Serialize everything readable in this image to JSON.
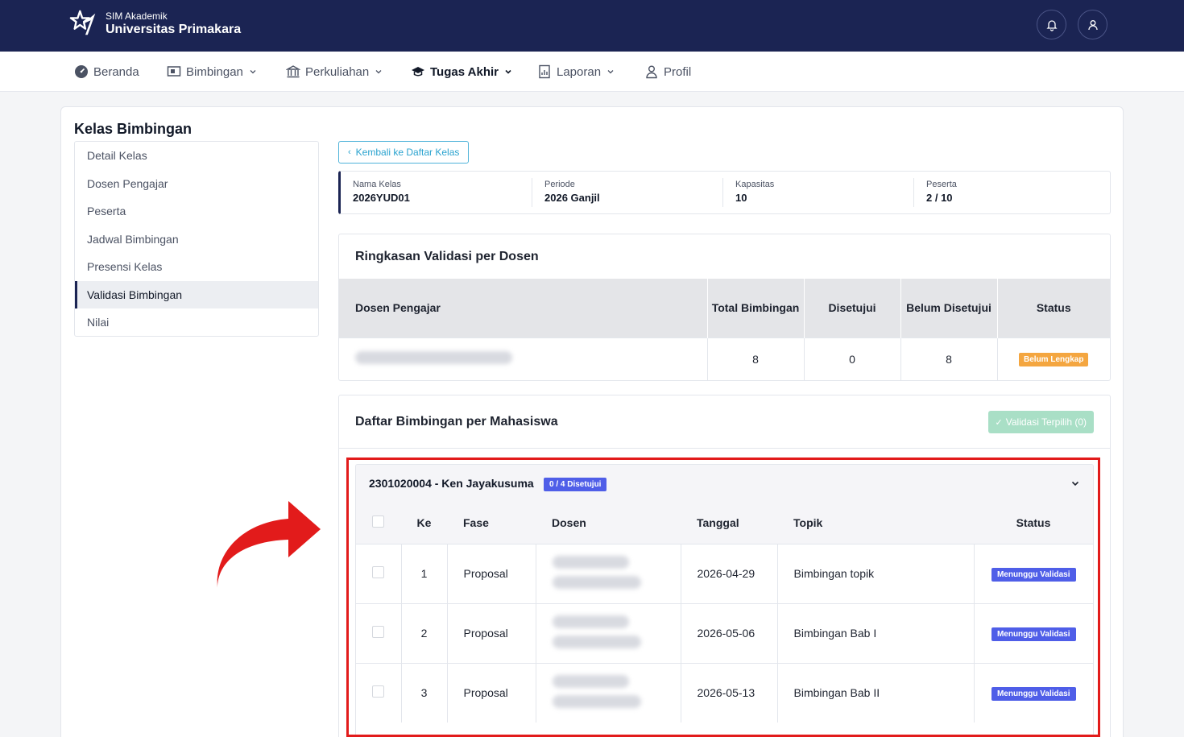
{
  "app": {
    "subtitle": "SIM Akademik",
    "title": "Universitas Primakara"
  },
  "header_icons": [
    "bell-icon",
    "user-icon"
  ],
  "nav": [
    {
      "label": "Beranda",
      "icon": "dashboard-icon",
      "dropdown": false,
      "active": false
    },
    {
      "label": "Bimbingan",
      "icon": "monitor-icon",
      "dropdown": true,
      "active": false
    },
    {
      "label": "Perkuliahan",
      "icon": "building-icon",
      "dropdown": true,
      "active": false
    },
    {
      "label": "Tugas Akhir",
      "icon": "graduation-cap-icon",
      "dropdown": true,
      "active": true
    },
    {
      "label": "Laporan",
      "icon": "report-icon",
      "dropdown": true,
      "active": false
    },
    {
      "label": "Profil",
      "icon": "person-icon",
      "dropdown": false,
      "active": false
    }
  ],
  "page_title": "Kelas Bimbingan",
  "sidebar": [
    {
      "label": "Detail Kelas",
      "active": false
    },
    {
      "label": "Dosen Pengajar",
      "active": false
    },
    {
      "label": "Peserta",
      "active": false
    },
    {
      "label": "Jadwal Bimbingan",
      "active": false
    },
    {
      "label": "Presensi Kelas",
      "active": false
    },
    {
      "label": "Validasi Bimbingan",
      "active": true
    },
    {
      "label": "Nilai",
      "active": false
    }
  ],
  "back_button": "Kembali ke Daftar Kelas",
  "info": [
    {
      "label": "Nama Kelas",
      "value": "2026YUD01"
    },
    {
      "label": "Periode",
      "value": "2026 Ganjil"
    },
    {
      "label": "Kapasitas",
      "value": "10"
    },
    {
      "label": "Peserta",
      "value": "2 / 10"
    }
  ],
  "summary": {
    "title": "Ringkasan Validasi per Dosen",
    "headers": {
      "dosen": "Dosen Pengajar",
      "total": "Total Bimbingan",
      "disetujui": "Disetujui",
      "belum": "Belum Disetujui",
      "status": "Status"
    },
    "row": {
      "total": "8",
      "disetujui": "0",
      "belum": "8",
      "status": "Belum Lengkap"
    },
    "status_color": "#f4a640"
  },
  "list": {
    "title": "Daftar Bimbingan per Mahasiswa",
    "validate_button": "Validasi Terpilih (0)",
    "student": {
      "name": "2301020004 - Ken Jayakusuma",
      "badge": "0 / 4 Disetujui",
      "headers": {
        "ke": "Ke",
        "fase": "Fase",
        "dosen": "Dosen",
        "tanggal": "Tanggal",
        "topik": "Topik",
        "status": "Status"
      },
      "rows": [
        {
          "ke": "1",
          "fase": "Proposal",
          "tanggal": "2026-04-29",
          "topik": "Bimbingan topik",
          "status": "Menunggu Validasi"
        },
        {
          "ke": "2",
          "fase": "Proposal",
          "tanggal": "2026-05-06",
          "topik": "Bimbingan Bab I",
          "status": "Menunggu Validasi"
        },
        {
          "ke": "3",
          "fase": "Proposal",
          "tanggal": "2026-05-13",
          "topik": "Bimbingan Bab II",
          "status": "Menunggu Validasi"
        }
      ]
    }
  },
  "colors": {
    "header_bg": "#1b2453",
    "accent_blue": "#4f5ee8",
    "highlight_red": "#e21b1b",
    "validate_green": "#a9dfc6"
  }
}
